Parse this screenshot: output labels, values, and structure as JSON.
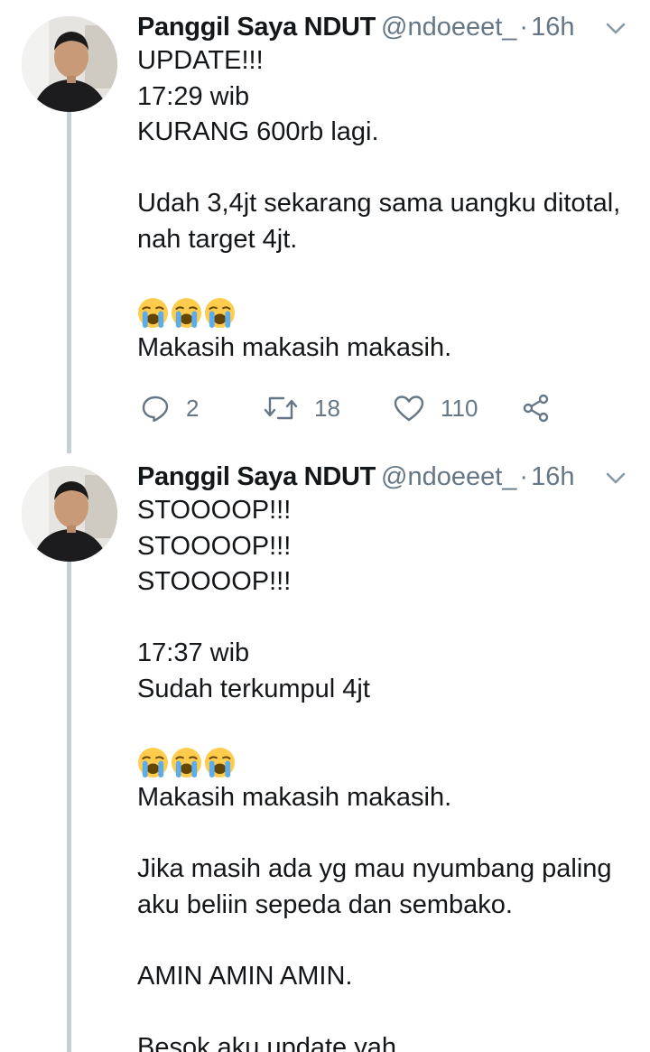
{
  "tweets": [
    {
      "name": "Panggil Saya NDUT",
      "handle": "@ndoeeet_",
      "separator": "·",
      "time": "16h",
      "lines_a": "UPDATE!!!\n17:29 wib\nKURANG 600rb lagi.",
      "lines_b": "Udah 3,4jt sekarang sama uangku ditotal,\nnah target 4jt.",
      "emojis": [
        "loudly-crying-face",
        "loudly-crying-face",
        "loudly-crying-face"
      ],
      "lines_c": "Makasih makasih makasih.",
      "reply_count": "2",
      "retweet_count": "18",
      "like_count": "110"
    },
    {
      "name": "Panggil Saya NDUT",
      "handle": "@ndoeeet_",
      "separator": "·",
      "time": "16h",
      "lines_a": "STOOOOP!!!\nSTOOOOP!!!\nSTOOOOP!!!",
      "lines_b": "17:37 wib\nSudah terkumpul 4jt",
      "emojis": [
        "loudly-crying-face",
        "loudly-crying-face",
        "loudly-crying-face"
      ],
      "lines_c": "Makasih makasih makasih.",
      "lines_d": "Jika masih ada yg mau nyumbang paling\naku beliin sepeda dan sembako.",
      "lines_e": "AMIN AMIN AMIN.",
      "lines_f": "Besok aku update yah."
    }
  ],
  "colors": {
    "text": "#14171a",
    "secondary": "#657786",
    "thread_line": "#c4cfd6"
  }
}
